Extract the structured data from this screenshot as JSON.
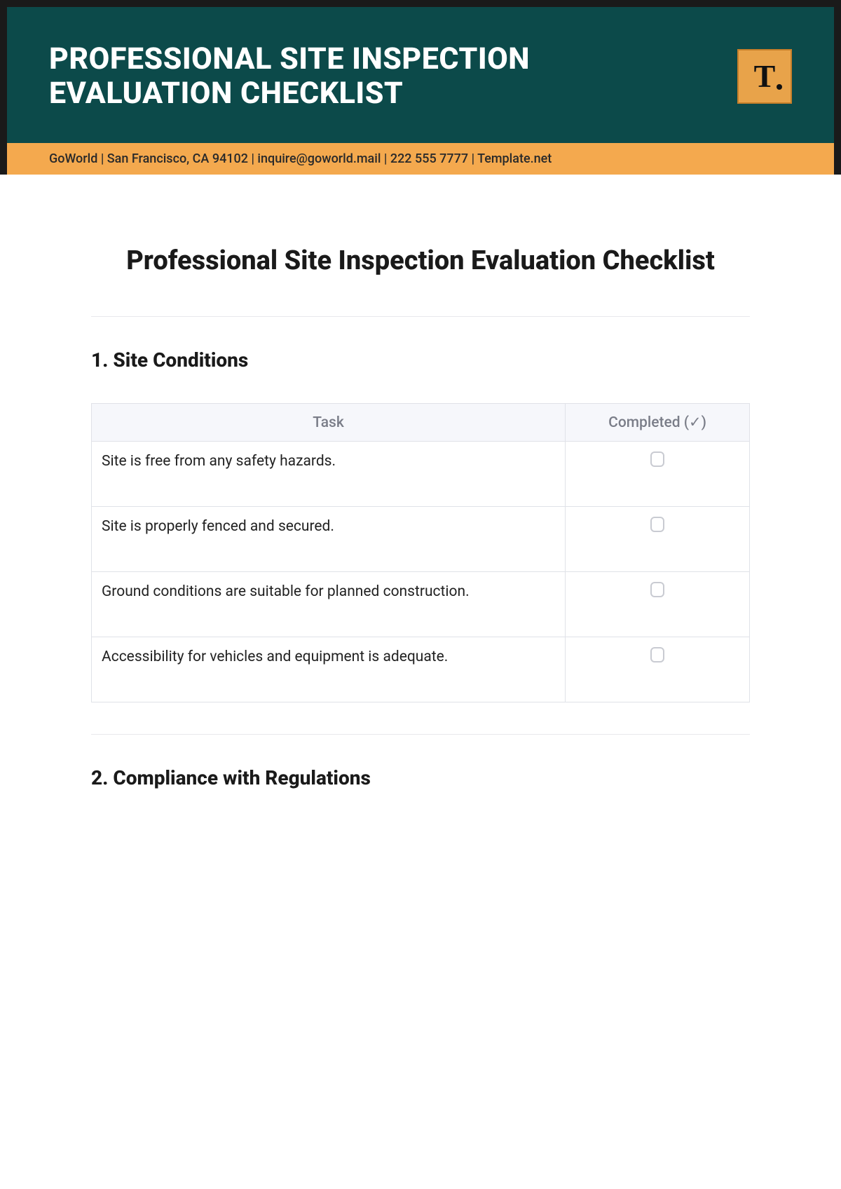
{
  "banner": {
    "title_line1": "PROFESSIONAL SITE INSPECTION",
    "title_line2": "EVALUATION CHECKLIST",
    "logo_text": "T",
    "sub": "GoWorld | San Francisco, CA 94102 | inquire@goworld.mail | 222 555 7777 | Template.net"
  },
  "doc": {
    "title": "Professional Site Inspection Evaluation Checklist"
  },
  "sections": [
    {
      "heading": "1. Site Conditions",
      "columns": {
        "task": "Task",
        "completed": "Completed (✓)"
      },
      "rows": [
        {
          "task": "Site is free from any safety hazards."
        },
        {
          "task": "Site is properly fenced and secured."
        },
        {
          "task": "Ground conditions are suitable for planned construction."
        },
        {
          "task": "Accessibility for vehicles and equipment is adequate."
        }
      ]
    },
    {
      "heading": "2. Compliance with Regulations"
    }
  ]
}
